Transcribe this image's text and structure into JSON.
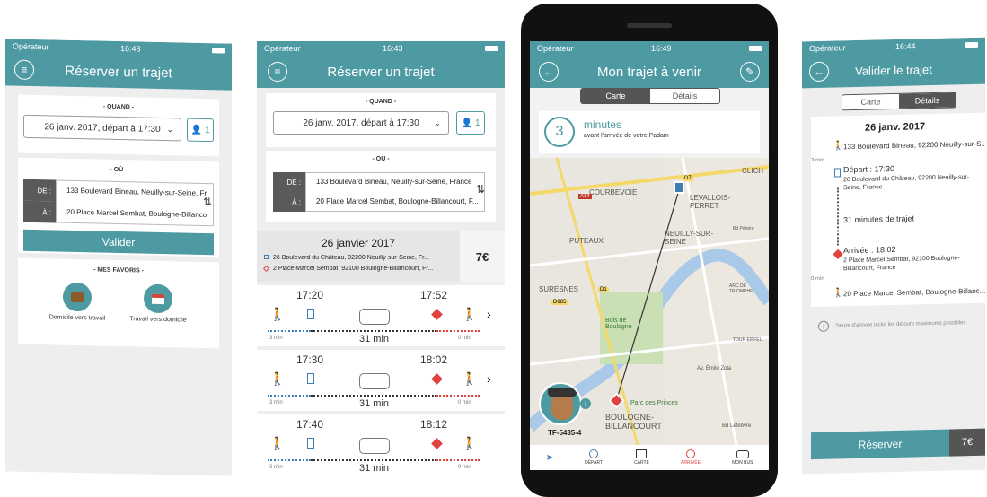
{
  "screen1": {
    "status": {
      "carrier": "Opérateur",
      "time": "16:43"
    },
    "title": "Réserver un trajet",
    "quand": "- QUAND -",
    "date": "26 janv. 2017, départ à 17:30",
    "passengers": "1",
    "ou": "- OÙ -",
    "de_label": "DE :",
    "a_label": "À :",
    "de_addr": "133 Boulevard Bineau, Neuilly-sur-Seine, France",
    "a_addr": "20 Place Marcel Sembat, Boulogne-Billancourt, F...",
    "valider": "Valider",
    "favoris": "- MES FAVORIS -",
    "fav1": "Domicile vers travail",
    "fav2": "Travail vers domicile"
  },
  "screen2": {
    "status": {
      "carrier": "Opérateur",
      "time": "16:43"
    },
    "title": "Réserver un trajet",
    "quand": "- QUAND -",
    "date": "26 janv. 2017, départ à 17:30",
    "passengers": "1",
    "ou": "- OÙ -",
    "de_label": "DE :",
    "a_label": "À :",
    "de_addr": "133 Boulevard Bineau, Neuilly-sur-Seine, France",
    "a_addr": "20 Place Marcel Sembat, Boulogne-Billancourt, F...",
    "result_date": "26 janvier 2017",
    "result_from": "26 Boulevard du Château, 92200 Neuilly-sur-Seine, Fr...",
    "result_to": "2 Place Marcel Sembat, 92100 Boulogne-Billancourt, Fr...",
    "price": "7€",
    "trips": [
      {
        "dep": "17:20",
        "arr": "17:52",
        "walk1": "3 min",
        "ride": "31 min",
        "walk2": "0 min"
      },
      {
        "dep": "17:30",
        "arr": "18:02",
        "walk1": "3 min",
        "ride": "31 min",
        "walk2": "0 min"
      },
      {
        "dep": "17:40",
        "arr": "18:12",
        "walk1": "3 min",
        "ride": "31 min",
        "walk2": "0 min"
      }
    ]
  },
  "screen3": {
    "status": {
      "carrier": "Opérateur",
      "time": "16:49"
    },
    "title": "Mon trajet à venir",
    "tab_carte": "Carte",
    "tab_details": "Détails",
    "eta_value": "3",
    "eta_unit": "minutes",
    "eta_text": "avant l'arrivée de votre Padam",
    "driver_plate": "TF-5435-4",
    "map_labels": [
      "COURBEVOIE",
      "LEVALLOIS-PERRET",
      "CLICH",
      "PUTEAUX",
      "NEUILLY-SUR-SEINE",
      "SURESNES",
      "BOULOGNE-BILLANCOURT",
      "Bois de Boulogne",
      "Parc des Princes",
      "ARC DE TRIOMPHE",
      "TOUR EIFFEL",
      "Av. Émile Zola",
      "Bd Lefebvre",
      "Bd Péreire",
      "A14",
      "D7",
      "D1",
      "D985"
    ],
    "tabbar": [
      "DÉPART",
      "CARTE",
      "ARRIVÉE",
      "MON BUS"
    ]
  },
  "screen4": {
    "status": {
      "carrier": "Opérateur",
      "time": "16:44"
    },
    "title": "Valider le trajet",
    "tab_carte": "Carte",
    "tab_details": "Détails",
    "date": "26 janv. 2017",
    "walk_from": "133 Boulevard Bineau, 92200 Neuilly-sur-S...",
    "walk1_min": "3 min",
    "depart_label": "Départ : 17:30",
    "depart_addr": "26 Boulevard du Château, 92200 Neuilly-sur-Seine, France",
    "ride_text": "31 minutes de trajet",
    "arrivee_label": "Arrivée : 18:02",
    "arrivee_addr": "2 Place Marcel Sembat, 92100 Boulogne-Billancourt, France",
    "walk2_min": "0 min",
    "walk_to": "20 Place Marcel Sembat, Boulogne-Billanc...",
    "note": "L'heure d'arrivée inclut les détours maximums possibles.",
    "reserver": "Réserver",
    "price": "7€"
  }
}
